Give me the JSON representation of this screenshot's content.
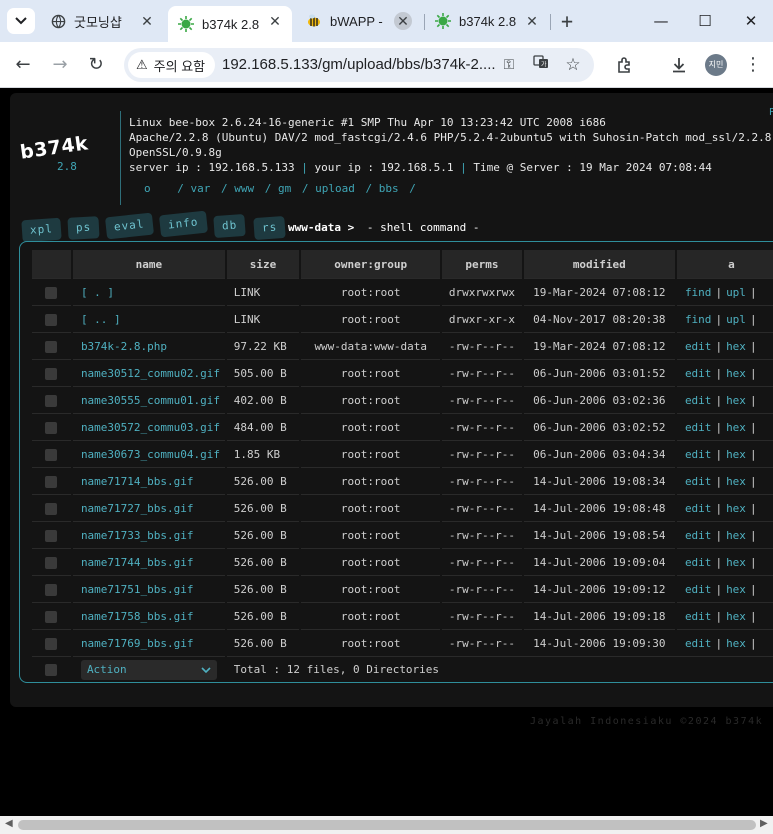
{
  "browser": {
    "tabs": [
      {
        "title": "굿모닝샵",
        "icon": "globe-icon"
      },
      {
        "title": "b374k 2.8",
        "icon": "virus-icon",
        "active": true
      },
      {
        "title": "bWAPP -",
        "icon": "bee-icon"
      },
      {
        "title": "b374k 2.8",
        "icon": "virus-icon"
      }
    ],
    "new_tab": "+",
    "security_label": "주의 요함",
    "url": "192.168.5.133/gm/upload/bbs/b374k-2....",
    "profile_label": "지민"
  },
  "shell": {
    "logo": "b374k",
    "version": "2.8",
    "info_lines": [
      "Linux bee-box 2.6.24-16-generic #1 SMP Thu Apr 10 13:23:42 UTC 2008 i686",
      "Apache/2.2.8 (Ubuntu) DAV/2 mod_fastcgi/2.4.6 PHP/5.2.4-2ubuntu5 with Suhosin-Patch mod_ssl/2.2.8",
      "OpenSSL/0.9.8g"
    ],
    "server_ip": "server ip : 192.168.5.133",
    "your_ip": "your ip : 192.168.5.1",
    "time_server": "Time @ Server : 19 Mar 2024 07:08:44",
    "path": [
      "o",
      "/ var",
      "/ www",
      "/ gm",
      "/ upload",
      "/ bbs",
      "/"
    ],
    "corner": "P",
    "menu": [
      "xpl",
      "ps",
      "eval",
      "info",
      "db",
      "rs"
    ],
    "user": "www-data >",
    "command": "- shell command -",
    "columns": [
      "name",
      "size",
      "owner:group",
      "perms",
      "modified",
      "a"
    ],
    "files": [
      {
        "name": "[ . ]",
        "size": "LINK",
        "owner": "root:root",
        "perms": "drwxrwxrwx",
        "modified": "19-Mar-2024 07:08:12",
        "a1": "find",
        "a2": "upl"
      },
      {
        "name": "[ .. ]",
        "size": "LINK",
        "owner": "root:root",
        "perms": "drwxr-xr-x",
        "modified": "04-Nov-2017 08:20:38",
        "a1": "find",
        "a2": "upl"
      },
      {
        "name": "b374k-2.8.php",
        "size": "97.22 KB",
        "owner": "www-data:www-data",
        "perms": "-rw-r--r--",
        "modified": "19-Mar-2024 07:08:12",
        "a1": "edit",
        "a2": "hex"
      },
      {
        "name": "name30512_commu02.gif",
        "size": "505.00 B",
        "owner": "root:root",
        "perms": "-rw-r--r--",
        "modified": "06-Jun-2006 03:01:52",
        "a1": "edit",
        "a2": "hex"
      },
      {
        "name": "name30555_commu01.gif",
        "size": "402.00 B",
        "owner": "root:root",
        "perms": "-rw-r--r--",
        "modified": "06-Jun-2006 03:02:36",
        "a1": "edit",
        "a2": "hex"
      },
      {
        "name": "name30572_commu03.gif",
        "size": "484.00 B",
        "owner": "root:root",
        "perms": "-rw-r--r--",
        "modified": "06-Jun-2006 03:02:52",
        "a1": "edit",
        "a2": "hex"
      },
      {
        "name": "name30673_commu04.gif",
        "size": "1.85 KB",
        "owner": "root:root",
        "perms": "-rw-r--r--",
        "modified": "06-Jun-2006 03:04:34",
        "a1": "edit",
        "a2": "hex"
      },
      {
        "name": "name71714_bbs.gif",
        "size": "526.00 B",
        "owner": "root:root",
        "perms": "-rw-r--r--",
        "modified": "14-Jul-2006 19:08:34",
        "a1": "edit",
        "a2": "hex"
      },
      {
        "name": "name71727_bbs.gif",
        "size": "526.00 B",
        "owner": "root:root",
        "perms": "-rw-r--r--",
        "modified": "14-Jul-2006 19:08:48",
        "a1": "edit",
        "a2": "hex"
      },
      {
        "name": "name71733_bbs.gif",
        "size": "526.00 B",
        "owner": "root:root",
        "perms": "-rw-r--r--",
        "modified": "14-Jul-2006 19:08:54",
        "a1": "edit",
        "a2": "hex"
      },
      {
        "name": "name71744_bbs.gif",
        "size": "526.00 B",
        "owner": "root:root",
        "perms": "-rw-r--r--",
        "modified": "14-Jul-2006 19:09:04",
        "a1": "edit",
        "a2": "hex"
      },
      {
        "name": "name71751_bbs.gif",
        "size": "526.00 B",
        "owner": "root:root",
        "perms": "-rw-r--r--",
        "modified": "14-Jul-2006 19:09:12",
        "a1": "edit",
        "a2": "hex"
      },
      {
        "name": "name71758_bbs.gif",
        "size": "526.00 B",
        "owner": "root:root",
        "perms": "-rw-r--r--",
        "modified": "14-Jul-2006 19:09:18",
        "a1": "edit",
        "a2": "hex"
      },
      {
        "name": "name71769_bbs.gif",
        "size": "526.00 B",
        "owner": "root:root",
        "perms": "-rw-r--r--",
        "modified": "14-Jul-2006 19:09:30",
        "a1": "edit",
        "a2": "hex"
      }
    ],
    "action_label": "Action",
    "total": "Total : 12 files, 0 Directories",
    "footer": "Jayalah Indonesiaku ©2024 b374k"
  }
}
